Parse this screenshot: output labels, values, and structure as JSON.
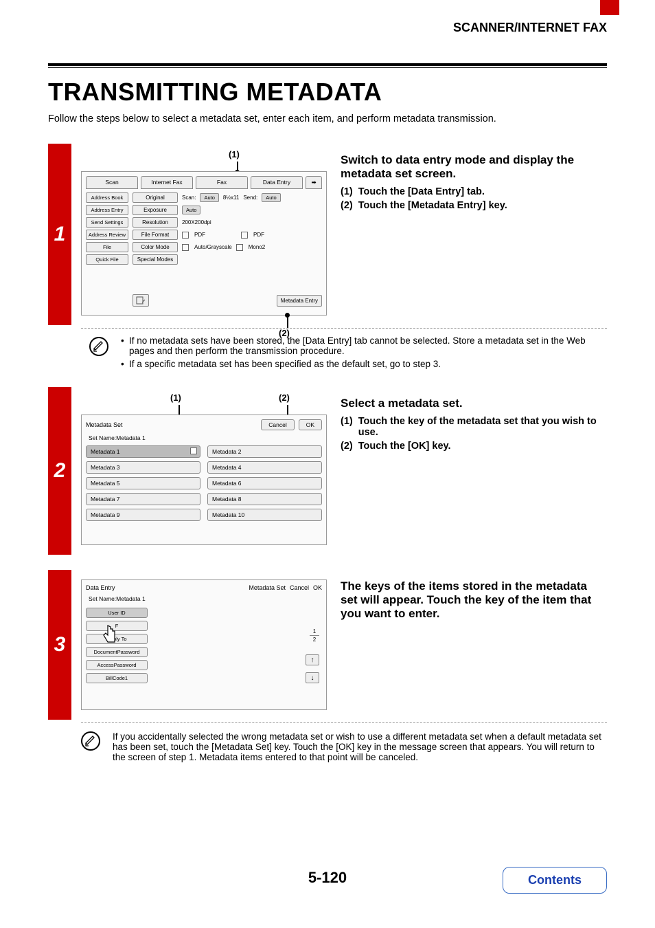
{
  "header": {
    "section": "SCANNER/INTERNET FAX"
  },
  "title": "TRANSMITTING METADATA",
  "intro": "Follow the steps below to select a metadata set, enter each item, and perform metadata transmission.",
  "step1": {
    "num": "1",
    "heading": "Switch to data entry mode and display the metadata set screen.",
    "sub1_n": "(1)",
    "sub1_t": "Touch the [Data Entry] tab.",
    "sub2_n": "(2)",
    "sub2_t": "Touch the [Metadata Entry] key.",
    "callout1": "(1)",
    "callout2": "(2)",
    "panel": {
      "tabs": {
        "scan": "Scan",
        "ifax": "Internet Fax",
        "fax": "Fax",
        "data": "Data Entry"
      },
      "left": {
        "addrbook": "Address Book",
        "addrentry": "Address Entry",
        "sendset": "Send Settings",
        "addrrev": "Address Review",
        "file": "File",
        "quick": "Quick File"
      },
      "rows": {
        "original": "Original",
        "scan": "Scan:",
        "auto": "Auto",
        "size": "8½x11",
        "send": "Send:",
        "auto2": "Auto",
        "exposure": "Exposure",
        "auto3": "Auto",
        "resolution": "Resolution",
        "res": "200X200dpi",
        "fileformat": "File Format",
        "pdf1": "PDF",
        "pdf2": "PDF",
        "colormode": "Color Mode",
        "gray": "Auto/Grayscale",
        "mono": "Mono2",
        "special": "Special Modes"
      },
      "metaentry": "Metadata Entry"
    }
  },
  "note1": {
    "b1": "If no metadata sets have been stored, the [Data Entry] tab cannot be selected. Store a metadata set in the Web pages and then perform the transmission procedure.",
    "b2": "If a specific metadata set has been specified as the default set, go to step 3."
  },
  "step2": {
    "num": "2",
    "heading": "Select a metadata set.",
    "sub1_n": "(1)",
    "sub1_t": "Touch the key of the metadata set that you wish to use.",
    "sub2_n": "(2)",
    "sub2_t": "Touch the [OK] key.",
    "callout1": "(1)",
    "callout2": "(2)",
    "panel": {
      "title": "Metadata Set",
      "cancel": "Cancel",
      "ok": "OK",
      "setname_lbl": "Set Name:",
      "setname_val": "Metadata 1",
      "items": [
        "Metadata 1",
        "Metadata 2",
        "Metadata 3",
        "Metadata 4",
        "Metadata 5",
        "Metadata 6",
        "Metadata 7",
        "Metadata 8",
        "Metadata 9",
        "Metadata 10"
      ]
    }
  },
  "step3": {
    "num": "3",
    "heading": "The keys of the items stored in the metadata set will appear. Touch the key of the item that you want to enter.",
    "panel": {
      "title": "Data Entry",
      "metaset": "Metadata Set",
      "cancel": "Cancel",
      "ok": "OK",
      "setname_lbl": "Set Name:",
      "setname_val": "Metadata 1",
      "items": [
        "User ID",
        "F",
        "Reply To",
        "DocumentPassword",
        "AccessPassword",
        "BillCode1"
      ],
      "pg_top": "1",
      "pg_bot": "2",
      "up": "↑",
      "down": "↓"
    }
  },
  "note3": {
    "text": "If you accidentally selected the wrong metadata set or wish to use a different metadata set when a default metadata set has been set, touch the [Metadata Set] key. Touch the [OK] key in the message screen that appears. You will return to the screen of step 1. Metadata items entered to that point will be canceled."
  },
  "page_number": "5-120",
  "contents": "Contents"
}
